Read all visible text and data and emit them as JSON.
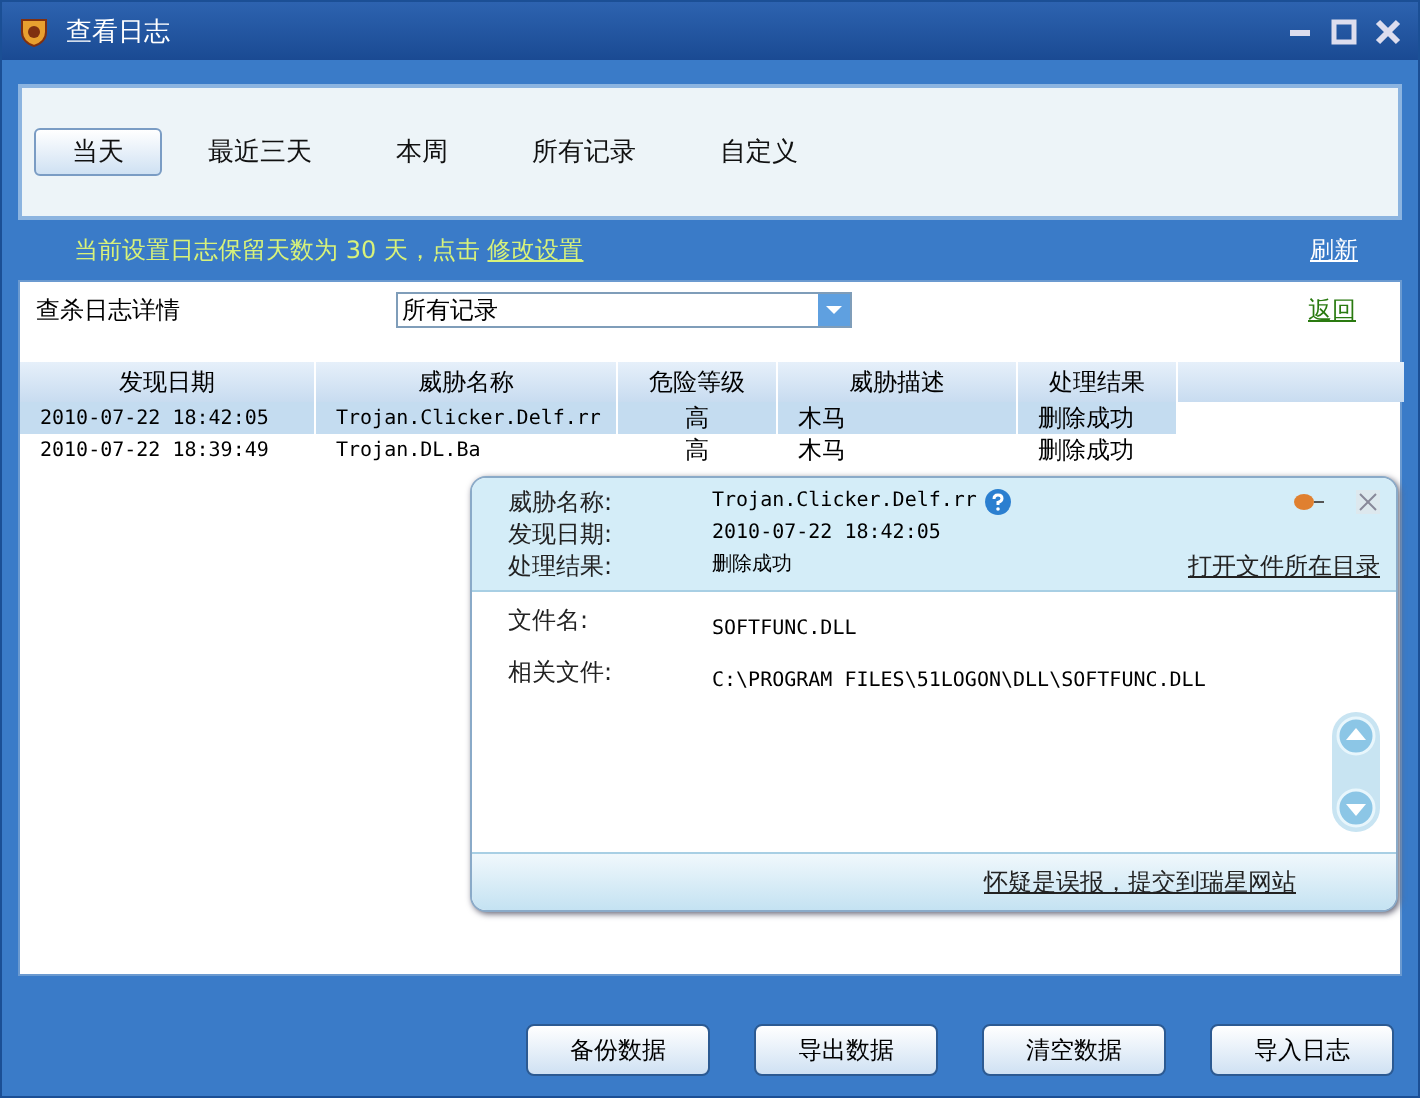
{
  "window": {
    "title": "查看日志"
  },
  "tabs": [
    {
      "label": "当天",
      "selected": true
    },
    {
      "label": "最近三天",
      "selected": false
    },
    {
      "label": "本周",
      "selected": false
    },
    {
      "label": "所有记录",
      "selected": false
    },
    {
      "label": "自定义",
      "selected": false
    }
  ],
  "notice": {
    "text": "当前设置日志保留天数为 30 天，点击",
    "link": "修改设置"
  },
  "refresh": "刷新",
  "filter": {
    "label": "查杀日志详情",
    "value": "所有记录"
  },
  "back": "返回",
  "table": {
    "columns": [
      "发现日期",
      "威胁名称",
      "危险等级",
      "威胁描述",
      "处理结果"
    ],
    "rows": [
      {
        "selected": true,
        "cells": [
          "2010-07-22 18:42:05",
          "Trojan.Clicker.Delf.rr",
          "高",
          "木马",
          "删除成功"
        ]
      },
      {
        "selected": false,
        "cells": [
          "2010-07-22 18:39:49",
          "Trojan.DL.Ba",
          "高",
          "木马",
          "删除成功"
        ]
      }
    ]
  },
  "detail": {
    "header": [
      {
        "label": "威胁名称:",
        "value": "Trojan.Clicker.Delf.rr"
      },
      {
        "label": "发现日期:",
        "value": "2010-07-22 18:42:05"
      },
      {
        "label": "处理结果:",
        "value": "删除成功"
      }
    ],
    "open_folder": "打开文件所在目录",
    "fields": [
      {
        "label": "文件名:",
        "value": "SOFTFUNC.DLL"
      },
      {
        "label": "相关文件:",
        "value": "C:\\PROGRAM FILES\\51LOGON\\DLL\\SOFTFUNC.DLL"
      }
    ],
    "report": "怀疑是误报，提交到瑞星网站"
  },
  "buttons": [
    "备份数据",
    "导出数据",
    "清空数据",
    "导入日志"
  ]
}
